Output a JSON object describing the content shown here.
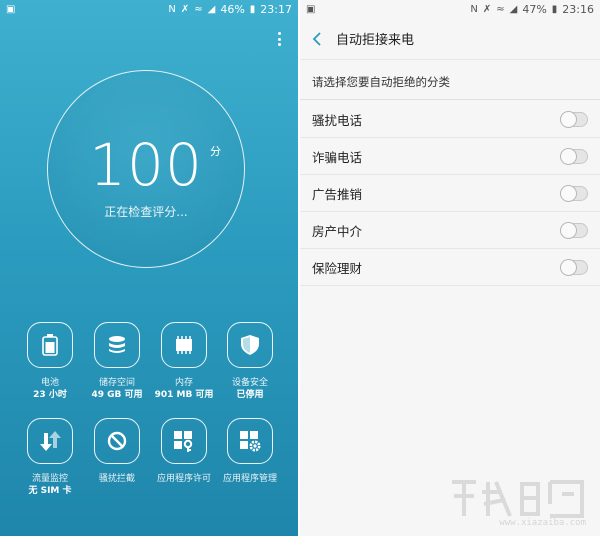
{
  "left": {
    "statusbar": {
      "battery": "46%",
      "time": "23:17"
    },
    "score": {
      "value": "100",
      "unit": "分",
      "status": "正在检查评分..."
    },
    "tiles": [
      {
        "label": "电池",
        "value": "23 小时",
        "icon": "battery-icon"
      },
      {
        "label": "储存空间",
        "value": "49 GB 可用",
        "icon": "storage-icon"
      },
      {
        "label": "内存",
        "value": "901 MB 可用",
        "icon": "memory-icon"
      },
      {
        "label": "设备安全",
        "value": "已停用",
        "icon": "shield-icon"
      },
      {
        "label": "流量监控",
        "value": "无 SIM 卡",
        "icon": "data-usage-icon"
      },
      {
        "label": "骚扰拦截",
        "value": "",
        "icon": "block-icon"
      },
      {
        "label": "应用程序许可",
        "value": "",
        "icon": "app-permission-icon"
      },
      {
        "label": "应用程序管理",
        "value": "",
        "icon": "app-manager-icon"
      }
    ]
  },
  "right": {
    "statusbar": {
      "battery": "47%",
      "time": "23:16"
    },
    "title": "自动拒接来电",
    "subtitle": "请选择您要自动拒绝的分类",
    "items": [
      {
        "label": "骚扰电话",
        "enabled": false
      },
      {
        "label": "诈骗电话",
        "enabled": false
      },
      {
        "label": "广告推销",
        "enabled": false
      },
      {
        "label": "房产中介",
        "enabled": false
      },
      {
        "label": "保险理财",
        "enabled": false
      }
    ],
    "accent_color": "#2a9bbf"
  },
  "watermark": {
    "url": "www.xiazaiba.com"
  }
}
